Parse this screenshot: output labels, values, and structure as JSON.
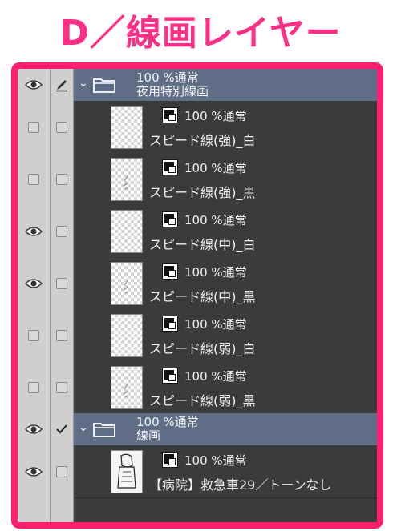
{
  "title": "D／線画レイヤー",
  "colors": {
    "title": "#ff2f87",
    "frame": "#ff1f6e",
    "folder_row": "#5f6e86",
    "panel": "#3c3c3c"
  },
  "icons": {
    "visibility": "eye-icon",
    "edit": "pen-icon",
    "check": "check-icon",
    "expand": "chevron-down-icon",
    "folder": "folder-icon",
    "layer_type": "raster-layer-icon"
  },
  "layers": [
    {
      "type": "folder",
      "blend": "100 %通常",
      "name": "夜用特別線画",
      "visible": true,
      "edit": "pen",
      "expanded": true
    },
    {
      "type": "layer",
      "blend": "100 %通常",
      "name": "スピード線(強)_白",
      "visible": false,
      "edit": "none"
    },
    {
      "type": "layer",
      "blend": "100 %通常",
      "name": "スピード線(強)_黒",
      "visible": false,
      "edit": "none"
    },
    {
      "type": "layer",
      "blend": "100 %通常",
      "name": "スピード線(中)_白",
      "visible": true,
      "edit": "none"
    },
    {
      "type": "layer",
      "blend": "100 %通常",
      "name": "スピード線(中)_黒",
      "visible": true,
      "edit": "none"
    },
    {
      "type": "layer",
      "blend": "100 %通常",
      "name": "スピード線(弱)_白",
      "visible": false,
      "edit": "none"
    },
    {
      "type": "layer",
      "blend": "100 %通常",
      "name": "スピード線(弱)_黒",
      "visible": false,
      "edit": "none"
    },
    {
      "type": "folder",
      "blend": "100 %通常",
      "name": "線画",
      "visible": true,
      "edit": "check",
      "expanded": true
    },
    {
      "type": "layer",
      "blend": "100 %通常",
      "name": "【病院】救急車29／トーンなし",
      "visible": true,
      "edit": "none"
    }
  ]
}
